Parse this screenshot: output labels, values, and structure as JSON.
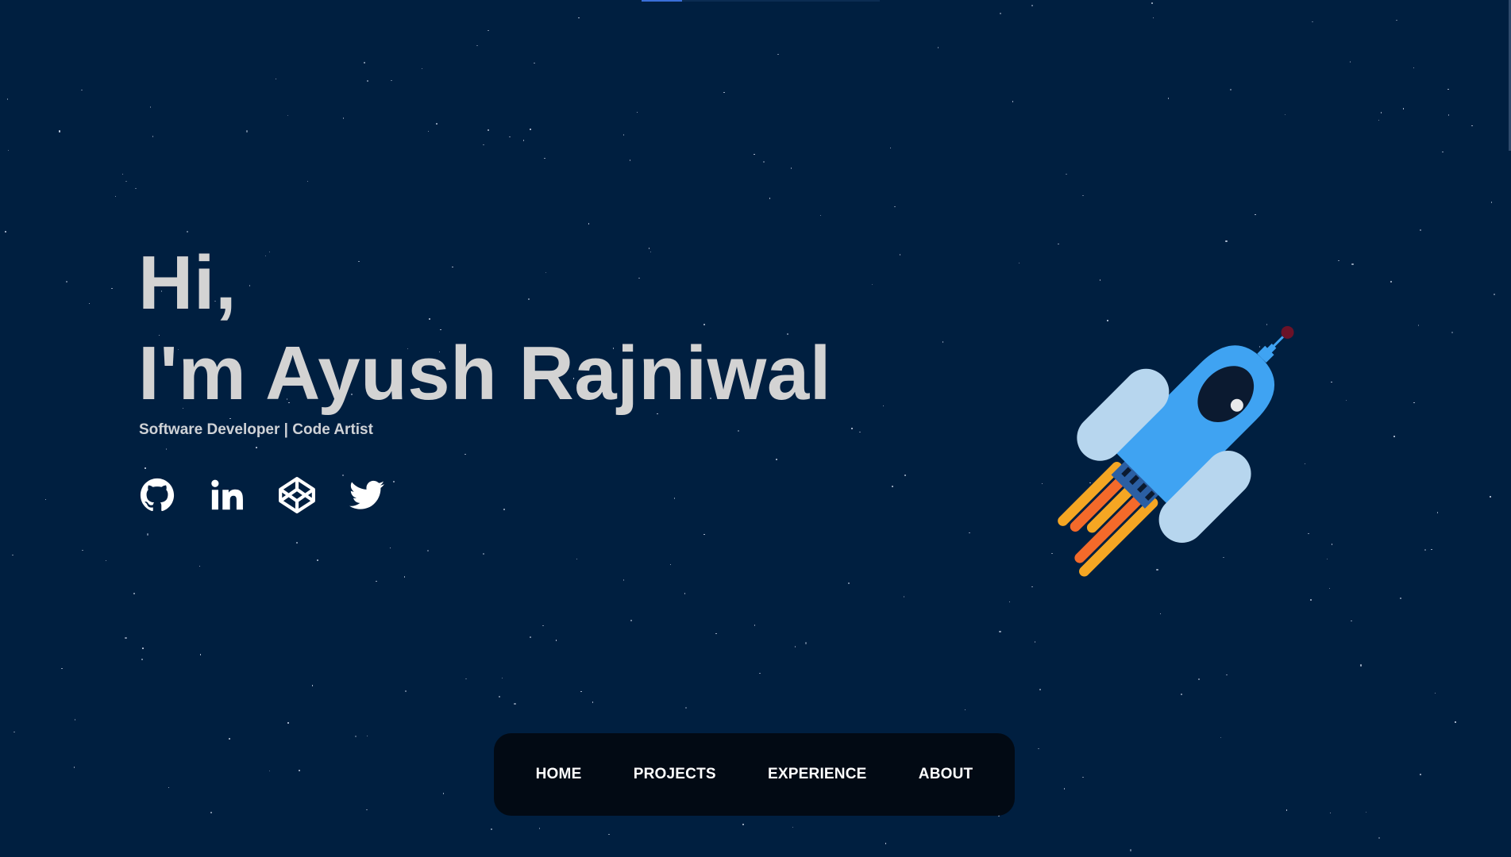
{
  "page": {
    "background": "#001f40",
    "accent": "#3a6fd8",
    "scroll_progress": 0.17
  },
  "hero": {
    "greeting_line1": "Hi,",
    "greeting_line2": "I'm Ayush Rajniwal",
    "subtitle": "Software Developer | Code Artist",
    "text_color": "#d3d3d3"
  },
  "socials": [
    {
      "name": "github",
      "icon": "github-icon"
    },
    {
      "name": "linkedin",
      "icon": "linkedin-icon"
    },
    {
      "name": "codepen",
      "icon": "codepen-icon"
    },
    {
      "name": "twitter",
      "icon": "twitter-icon"
    }
  ],
  "rocket": {
    "icon": "rocket-illustration",
    "body_color": "#3fa3f2",
    "fin_color": "#b7d6ee",
    "flame_colors": [
      "#f5a623",
      "#f46a2a"
    ]
  },
  "nav": {
    "items": [
      "HOME",
      "PROJECTS",
      "EXPERIENCE",
      "ABOUT"
    ],
    "background": "#020a14"
  }
}
